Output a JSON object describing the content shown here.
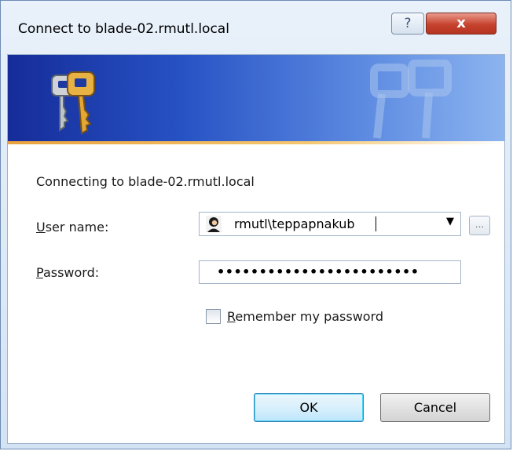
{
  "window": {
    "title": "Connect to blade-02.rmutl.local",
    "help_label": "?",
    "close_label": "x"
  },
  "banner": {
    "icon": "keys-icon"
  },
  "form": {
    "connecting_text": "Connecting to blade-02.rmutl.local",
    "username_label_first": "U",
    "username_label_rest": "ser name:",
    "username_value": "rmutl\\teppapnakub",
    "password_label_first": "P",
    "password_label_rest": "assword:",
    "password_mask": "••••••••••••••••••••••••",
    "browse_label": "...",
    "remember_label_first": "R",
    "remember_label_rest": "emember my password",
    "remember_checked": false
  },
  "buttons": {
    "ok_label": "OK",
    "cancel_label": "Cancel"
  },
  "colors": {
    "banner_dark": "#152c99",
    "banner_light": "#8cb4f0",
    "accent_stripe": "#e9a23d",
    "close_red": "#c6432e"
  }
}
